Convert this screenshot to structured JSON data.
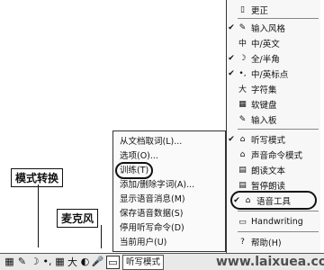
{
  "right_menu": {
    "items": [
      {
        "check": "",
        "icon": "▯",
        "label": "更正"
      },
      {
        "check": "✔",
        "icon": "✎",
        "label": "输入风格"
      },
      {
        "check": "",
        "icon": "中",
        "label": "中/英文"
      },
      {
        "check": "✔",
        "icon": "☽",
        "label": "全/半角"
      },
      {
        "check": "✔",
        "icon": "•,",
        "label": "中/英标点"
      },
      {
        "check": "",
        "icon": "大",
        "label": "字符集"
      },
      {
        "check": "",
        "icon": "▦",
        "label": "软键盘"
      },
      {
        "check": "",
        "icon": "✎",
        "label": "输入板"
      },
      {
        "check": "✔",
        "icon": "⌂",
        "label": "听写模式"
      },
      {
        "check": "",
        "icon": "⌂",
        "label": "声音命令模式"
      },
      {
        "check": "",
        "icon": "▤",
        "label": "朗读文本"
      },
      {
        "check": "",
        "icon": "▤",
        "label": "暂停朗读"
      },
      {
        "check": "✔",
        "icon": "⌂",
        "label": "语音工具"
      },
      {
        "check": "",
        "icon": "▭",
        "label": "Handwriting"
      },
      {
        "check": "",
        "icon": "?",
        "label": "帮助(H)"
      }
    ]
  },
  "left_menu": {
    "items": [
      "从文档取词(L)...",
      "选项(O)...",
      "训练(T)",
      "添加/删除字词(A)...",
      "显示语音消息(M)",
      "保存语音数据(S)",
      "停用听写命令(D)",
      "当前用户(U)"
    ]
  },
  "callouts": {
    "mode_switch": "模式转换",
    "microphone": "麦克风"
  },
  "taskbar": {
    "mode_label": "听写模式"
  },
  "watermark": "www.laixuea.com"
}
